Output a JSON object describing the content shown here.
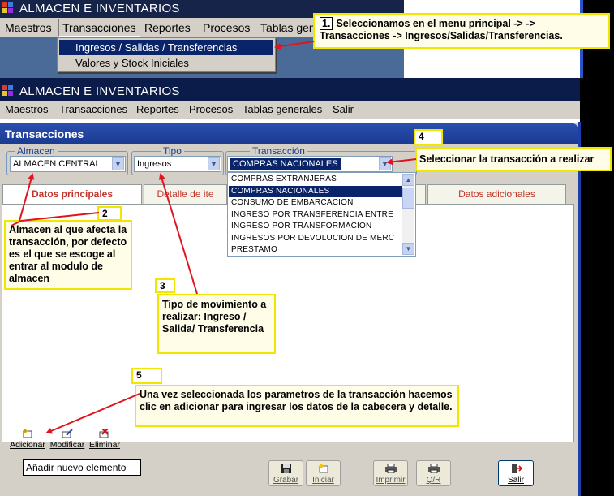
{
  "app": {
    "title": "ALMACEN E INVENTARIOS"
  },
  "win1": {
    "menu": [
      "Maestros",
      "Transacciones",
      "Reportes",
      "Procesos",
      "Tablas gene"
    ],
    "dropdown": [
      "Ingresos / Salidas / Transferencias",
      "Valores y Stock Iniciales"
    ]
  },
  "win2": {
    "menu": [
      "Maestros",
      "Transacciones",
      "Reportes",
      "Procesos",
      "Tablas generales",
      "Salir"
    ]
  },
  "form": {
    "title": "Transacciones",
    "almacen_label": "Almacen",
    "almacen_value": "ALMACEN CENTRAL",
    "tipo_label": "Tipo",
    "tipo_value": "Ingresos",
    "transaccion_label": "Transacción",
    "transaccion_value": "COMPRAS NACIONALES",
    "transaccion_options": [
      "COMPRAS EXTRANJERAS",
      "COMPRAS NACIONALES",
      "CONSUMO DE EMBARCACION",
      "INGRESO POR TRANSFERENCIA ENTRE",
      "INGRESO POR TRANSFORMACION",
      "INGRESOS POR DEVOLUCION DE MERC",
      "PRESTAMO"
    ],
    "tabs": [
      "Datos principales",
      "Detalle de ite",
      "Datos adicionales"
    ]
  },
  "toolbar": {
    "add": "Adicionar",
    "edit": "Modificar",
    "delete": "Eliminar",
    "tooltip": "Añadir nuevo elemento"
  },
  "bottom_buttons": {
    "save": "Grabar",
    "init": "Iniciar",
    "print": "Imprimir",
    "qr": "Q/R",
    "exit": "Salir"
  },
  "callouts": {
    "c1_num": "1.",
    "c1_text": "Seleccionamos en el menu principal ->  -> Transacciones -> Ingresos/Salidas/Transferencias.",
    "c2_num": "2",
    "c2_text": "Almacen al que afecta la transacción, por defecto es el que se escoge al entrar al modulo de almacen",
    "c3_num": "3",
    "c3_text": "Tipo de movimiento a realizar: Ingreso / Salida/ Transferencia",
    "c4_num": "4",
    "c4_text": "Seleccionar la transacción a realizar",
    "c5_num": "5",
    "c5_text": "Una vez seleccionada los parametros de la transacción hacemos clic en adicionar para ingresar los datos de la cabecera y detalle."
  },
  "colors": {
    "callout_border": "#f1e600",
    "arrow": "#e0141e",
    "title_bar": "#0c1c4a",
    "selection": "#0a246a"
  }
}
